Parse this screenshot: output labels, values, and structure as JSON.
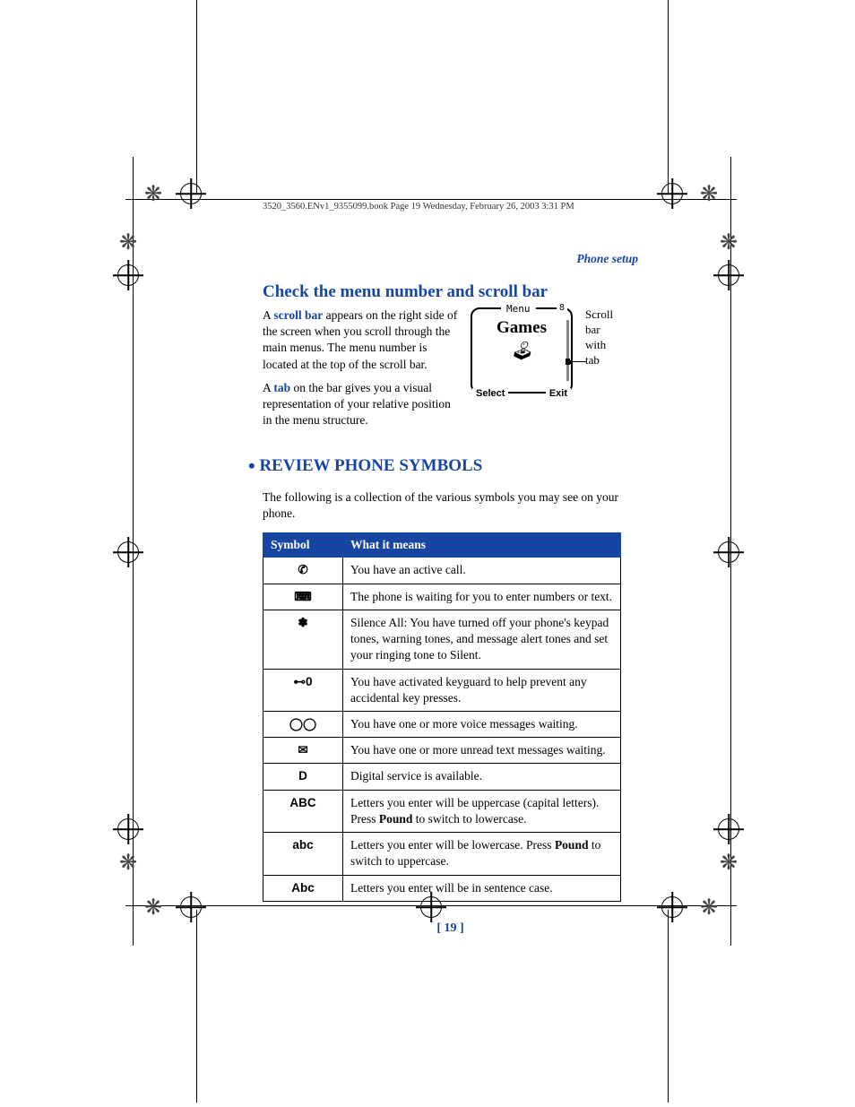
{
  "header": {
    "book_line": "3520_3560.ENv1_9355099.book  Page 19  Wednesday, February 26, 2003  3:31 PM"
  },
  "section_label": "Phone setup",
  "subheading": "Check the menu number and scroll bar",
  "para1_a": "A ",
  "para1_bold": "scroll bar",
  "para1_b": " appears on the right side of the screen when you scroll through the main menus. The menu number is located at the top of the scroll bar.",
  "para2_a": "A ",
  "para2_bold": "tab",
  "para2_b": " on the bar gives you a visual representation of your relative position in the menu structure.",
  "figure": {
    "menu_label": "Menu",
    "menu_number": "8",
    "title": "Games",
    "select": "Select",
    "exit": "Exit",
    "caption_line1": "Scroll",
    "caption_line2": "bar",
    "caption_line3": "with",
    "caption_line4": "tab"
  },
  "main_heading": "REVIEW PHONE SYMBOLS",
  "intro": "The following is a collection of the various symbols you may see on your phone.",
  "table": {
    "col1": "Symbol",
    "col2": "What it means",
    "rows": [
      {
        "symbol_glyph": "✆",
        "meaning": "You have an active call."
      },
      {
        "symbol_glyph": "⌨",
        "meaning": "The phone is waiting for you to enter numbers or text."
      },
      {
        "symbol_glyph": "✽",
        "meaning": "Silence All: You have turned off your phone's keypad tones, warning tones, and message alert tones and set your ringing tone to Silent."
      },
      {
        "symbol_glyph": "⊷0",
        "meaning": "You have activated keyguard to help prevent any accidental key presses."
      },
      {
        "symbol_glyph": "◯◯",
        "meaning": "You have one or more voice messages waiting."
      },
      {
        "symbol_glyph": "✉",
        "meaning": "You have one or more unread text messages waiting."
      },
      {
        "symbol_glyph": "D",
        "meaning": "Digital service is available."
      },
      {
        "symbol_glyph": "ABC",
        "meaning_a": "Letters you enter will be uppercase (capital letters). Press ",
        "bold": "Pound",
        "meaning_b": " to switch to lowercase."
      },
      {
        "symbol_glyph": "abc",
        "meaning_a": "Letters you enter will be lowercase. Press ",
        "bold": "Pound",
        "meaning_b": " to switch to uppercase."
      },
      {
        "symbol_glyph": "Abc",
        "meaning": "Letters you enter will be in sentence case."
      }
    ]
  },
  "page_number": "[ 19 ]"
}
